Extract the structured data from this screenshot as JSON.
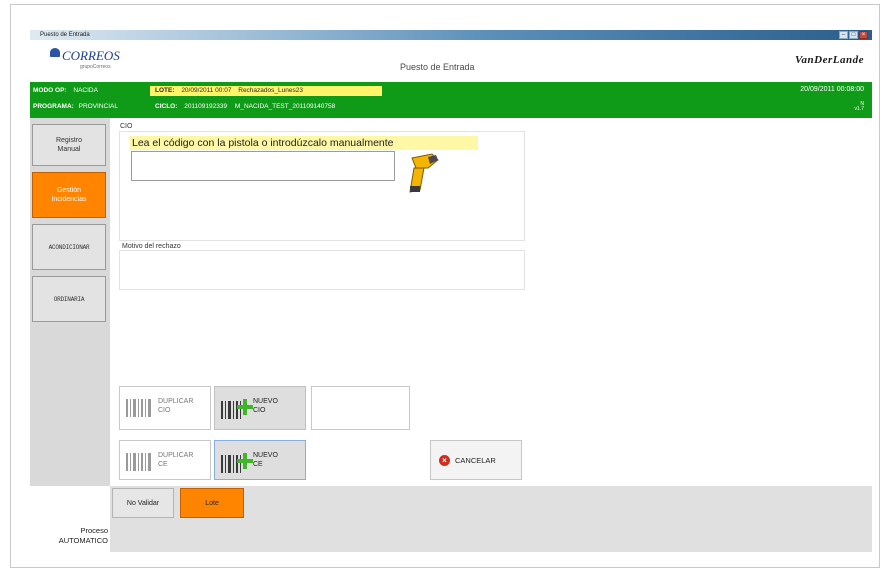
{
  "window": {
    "title": "Puesto de Entrada",
    "controls": [
      "minimize",
      "maximize",
      "close"
    ]
  },
  "brand": {
    "left_logo_text": "CORREOS",
    "left_logo_sub": "grupoCorreos",
    "screen_title": "Puesto de Entrada",
    "right_logo_text": "VanDerLande"
  },
  "status": {
    "modo_op_label": "MODO OP:",
    "modo_op_value": "NACIDA",
    "programa_label": "PROGRAMA:",
    "programa_value": "PROVINCIAL",
    "lote_label": "LOTE:",
    "lote_value": "20/09/2011 00:07",
    "lote_name": "Rechazados_Lunes23",
    "ciclo_label": "CICLO:",
    "ciclo_value": "201109192339",
    "ciclo_name": "M_NACIDA_TEST_201109140758",
    "datetime": "20/09/2011 00:08:00",
    "version_line1": "N",
    "version_line2": "v1.7"
  },
  "sidebar": {
    "items": [
      {
        "label": "Registro\nManual",
        "active": false
      },
      {
        "label": "Gestión\nIncidencias",
        "active": true
      },
      {
        "label": "ACONDICIONAR",
        "active": false
      },
      {
        "label": "ORDINARIA",
        "active": false
      }
    ]
  },
  "form": {
    "cio_label": "CIO",
    "scan_message": "Lea el código con la pistola o introdúzcalo manualmente",
    "cio_value": "",
    "motivo_label": "Motivo del rechazo",
    "motivo_value": ""
  },
  "actions": {
    "duplicar_cio": "DUPLICAR\nCIO",
    "nuevo_cio": "NUEVO\nCIO",
    "duplicar_ce": "DUPLICAR\nCE",
    "nuevo_ce": "NUEVO\nCE",
    "cancelar": "CANCELAR"
  },
  "footer": {
    "no_validar": "No Validar",
    "lote": "Lote",
    "proceso_line1": "Proceso",
    "proceso_line2": "AUTOMATICO"
  },
  "colors": {
    "status_bar": "#0f9a17",
    "highlight": "#fff46a",
    "active_button": "#ff8400",
    "cancel_icon": "#d22b1f"
  }
}
